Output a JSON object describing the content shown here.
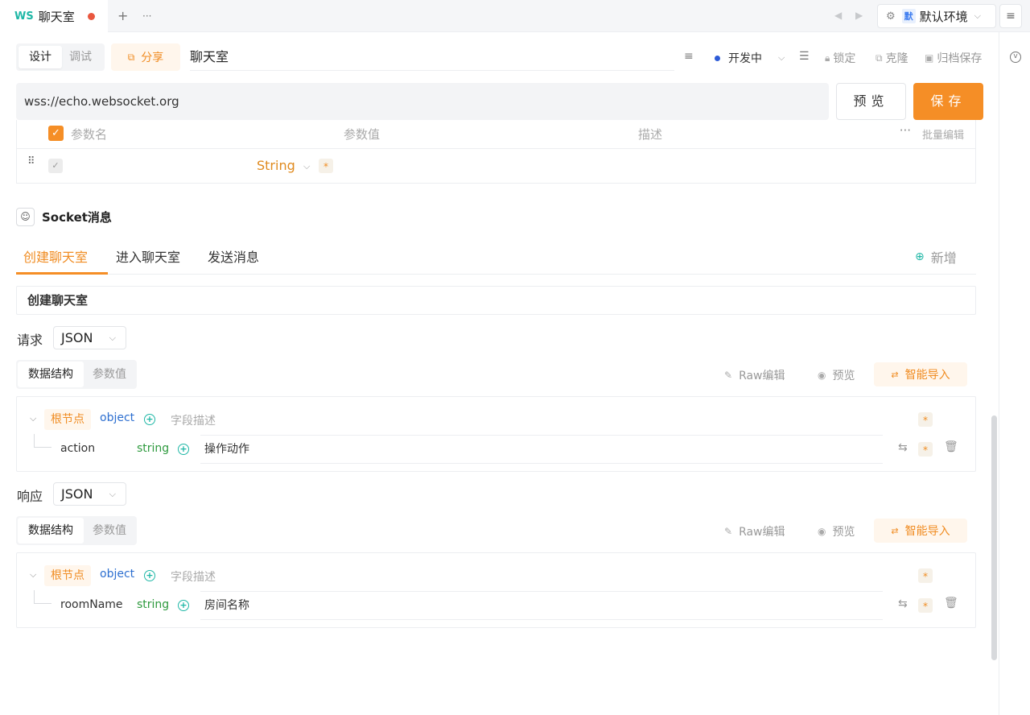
{
  "tabbar": {
    "badge": "WS",
    "title": "聊天室",
    "add": "+",
    "more": "···",
    "prev": "◀",
    "next": "▶",
    "env_mark": "默",
    "env_name": "默认环境",
    "menu": "≡"
  },
  "toolbar": {
    "mode_design": "设计",
    "mode_debug": "调试",
    "share_label": "分享",
    "doc_title": "聊天室",
    "status": "开发中",
    "lock": "锁定",
    "clone": "克隆",
    "archive": "归档保存"
  },
  "url": {
    "value": "wss://echo.websocket.org",
    "preview": "预览",
    "save": "保存"
  },
  "params": {
    "headers": [
      "参数名",
      "参数值",
      "描述"
    ],
    "batch_edit": "批量编辑",
    "row_type": "String",
    "required_mark": "*"
  },
  "socket": {
    "section_title": "Socket消息",
    "tabs": [
      "创建聊天室",
      "进入聊天室",
      "发送消息"
    ],
    "add_new": "新增",
    "message_name": "创建聊天室"
  },
  "request": {
    "label": "请求",
    "format": "JSON",
    "struct_tab": "数据结构",
    "value_tab": "参数值",
    "raw_edit": "Raw编辑",
    "preview": "预览",
    "smart_import": "智能导入",
    "root_label": "根节点",
    "root_type": "object",
    "root_desc_placeholder": "字段描述",
    "field": {
      "name": "action",
      "type": "string",
      "desc": "操作动作"
    }
  },
  "response": {
    "label": "响应",
    "format": "JSON",
    "struct_tab": "数据结构",
    "value_tab": "参数值",
    "raw_edit": "Raw编辑",
    "preview": "预览",
    "smart_import": "智能导入",
    "root_label": "根节点",
    "root_type": "object",
    "root_desc_placeholder": "字段描述",
    "field": {
      "name": "roomName",
      "type": "string",
      "desc": "房间名称"
    }
  },
  "colors": {
    "accent": "#f58e26",
    "teal": "#1fb7a6",
    "status_dot": "#2d5bd7"
  }
}
